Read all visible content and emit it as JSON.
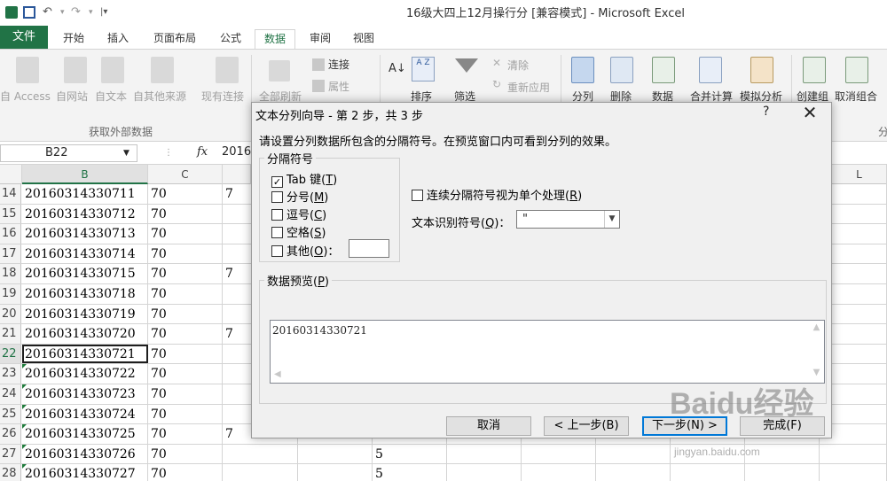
{
  "window": {
    "title": "16级大四上12月操行分  [兼容模式] - Microsoft Excel"
  },
  "tabs": [
    "文件",
    "开始",
    "插入",
    "页面布局",
    "公式",
    "数据",
    "审阅",
    "视图"
  ],
  "ribbon": {
    "get_external": [
      "自 Access",
      "自网站",
      "自文本",
      "自其他来源",
      "现有连接"
    ],
    "refresh_all": "全部刷新",
    "connections": [
      "连接",
      "属性"
    ],
    "sort": "排序",
    "filter": "筛选",
    "clear": "清除",
    "reapply": "重新应用",
    "tools": [
      "分列",
      "删除",
      "数据",
      "合并计算",
      "模拟分析",
      "创建组",
      "取消组合"
    ],
    "group_label": "获取外部数据",
    "group_label_right": "分"
  },
  "formula_bar": {
    "name_box": "B22",
    "fx": "fx",
    "value": "2016"
  },
  "columns": [
    "B",
    "C",
    "L"
  ],
  "rows": [
    {
      "n": "14",
      "b": "20160314330711",
      "c": "70",
      "d": "7",
      "tri": false
    },
    {
      "n": "15",
      "b": "20160314330712",
      "c": "70",
      "d": "",
      "tri": false
    },
    {
      "n": "16",
      "b": "20160314330713",
      "c": "70",
      "d": "",
      "tri": false
    },
    {
      "n": "17",
      "b": "20160314330714",
      "c": "70",
      "d": "",
      "tri": false
    },
    {
      "n": "18",
      "b": "20160314330715",
      "c": "70",
      "d": "7",
      "tri": false
    },
    {
      "n": "19",
      "b": "20160314330718",
      "c": "70",
      "d": "",
      "tri": false
    },
    {
      "n": "20",
      "b": "20160314330719",
      "c": "70",
      "d": "",
      "tri": false
    },
    {
      "n": "21",
      "b": "20160314330720",
      "c": "70",
      "d": "7",
      "tri": false
    },
    {
      "n": "22",
      "b": "20160314330721",
      "c": "70",
      "d": "",
      "tri": false
    },
    {
      "n": "23",
      "b": "20160314330722",
      "c": "70",
      "d": "",
      "tri": true
    },
    {
      "n": "24",
      "b": "20160314330723",
      "c": "70",
      "d": "",
      "tri": true
    },
    {
      "n": "25",
      "b": "20160314330724",
      "c": "70",
      "d": "",
      "tri": true
    },
    {
      "n": "26",
      "b": "20160314330725",
      "c": "70",
      "d": "7",
      "tri": true
    },
    {
      "n": "27",
      "b": "20160314330726",
      "c": "70",
      "d": "",
      "tri": true,
      "g": "5"
    },
    {
      "n": "28",
      "b": "20160314330727",
      "c": "70",
      "d": "",
      "tri": true,
      "g": "5"
    }
  ],
  "dialog": {
    "title": "文本分列向导 - 第 2 步，共 3 步",
    "help": "?",
    "close": "✕",
    "description": "请设置分列数据所包含的分隔符号。在预览窗口内可看到分列的效果。",
    "delimiters_label": "分隔符号",
    "tab": {
      "label": "Tab 键(",
      "key": "T",
      "end": ")",
      "checked": "✓"
    },
    "semicolon": {
      "label": "分号(",
      "key": "M",
      "end": ")"
    },
    "comma": {
      "label": "逗号(",
      "key": "C",
      "end": ")"
    },
    "space": {
      "label": "空格(",
      "key": "S",
      "end": ")"
    },
    "other": {
      "label": "其他(",
      "key": "O",
      "end": ")："
    },
    "consecutive": {
      "label": "连续分隔符号视为单个处理(",
      "key": "R",
      "end": ")"
    },
    "qualifier": {
      "label": "文本识别符号(",
      "key": "Q",
      "end": ")：",
      "value": "\""
    },
    "preview_label": "数据预览(",
    "preview_key": "P",
    "preview_end": ")",
    "preview_text": "20160314330721",
    "buttons": {
      "cancel": "取消",
      "back": "< 上一步(B)",
      "next": "下一步(N) >",
      "finish": "完成(F)"
    }
  },
  "watermark": {
    "main": "Baidu经验",
    "sub": "jingyan.baidu.com"
  }
}
